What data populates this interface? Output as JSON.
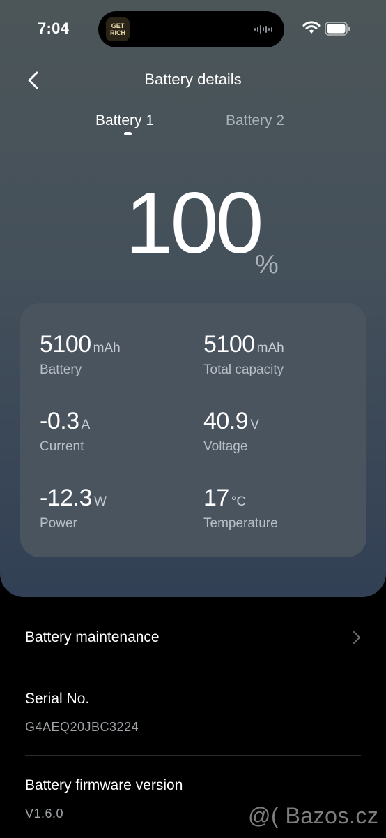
{
  "status_bar": {
    "time": "7:04",
    "island_logo_text": "GET RICH"
  },
  "header": {
    "title": "Battery details"
  },
  "tabs": [
    {
      "label": "Battery 1",
      "active": true
    },
    {
      "label": "Battery 2",
      "active": false
    }
  ],
  "charge": {
    "value": "100",
    "unit": "%"
  },
  "metrics": [
    {
      "value": "5100",
      "unit": "mAh",
      "label": "Battery"
    },
    {
      "value": "5100",
      "unit": "mAh",
      "label": "Total capacity"
    },
    {
      "value": "-0.3",
      "unit": "A",
      "label": "Current"
    },
    {
      "value": "40.9",
      "unit": "V",
      "label": "Voltage"
    },
    {
      "value": "-12.3",
      "unit": "W",
      "label": "Power"
    },
    {
      "value": "17",
      "unit": "°C",
      "label": "Temperature"
    }
  ],
  "list": {
    "maintenance": {
      "title": "Battery maintenance"
    },
    "serial": {
      "title": "Serial No.",
      "value": "G4AEQ20JBC3224"
    },
    "firmware": {
      "title": "Battery firmware version",
      "value": "V1.6.0"
    }
  },
  "watermark": "@( Bazos.cz",
  "colors": {
    "panel_top": "#4c5659",
    "panel_bottom": "#324055",
    "card": "#4a545f",
    "background": "#000000"
  },
  "icons": [
    "back-arrow-icon",
    "wifi-icon",
    "battery-icon",
    "chevron-right-icon"
  ]
}
